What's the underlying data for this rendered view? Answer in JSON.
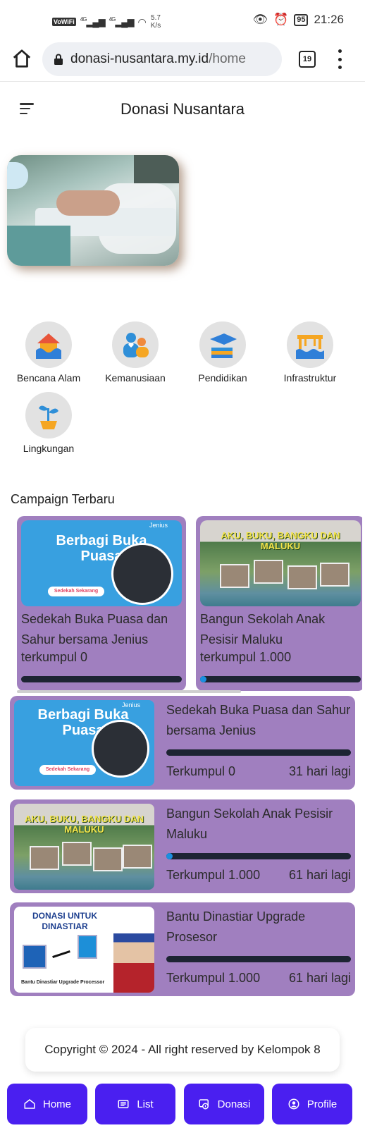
{
  "status_bar": {
    "wifi_label": "VoWiFi",
    "signal_1": "4G",
    "signal_2": "4G",
    "speed_value": "5.7",
    "speed_unit": "K/s",
    "battery": "95",
    "time": "21:26"
  },
  "browser": {
    "url_domain": "donasi-nusantara.my.id",
    "url_path": "/home",
    "tab_count": "19"
  },
  "header": {
    "title": "Donasi Nusantara"
  },
  "categories": [
    {
      "label": "Bencana Alam",
      "icon": "house-flood-icon"
    },
    {
      "label": "Kemanusiaan",
      "icon": "people-heart-icon"
    },
    {
      "label": "Pendidikan",
      "icon": "graduation-cap-icon"
    },
    {
      "label": "Infrastruktur",
      "icon": "bridge-icon"
    },
    {
      "label": "Lingkungan",
      "icon": "plant-sprout-icon"
    }
  ],
  "section": {
    "title": "Campaign Terbaru"
  },
  "carousel": [
    {
      "title": "Sedekah Buka Puasa dan Sahur bersama Jenius",
      "raised_text": "terkumpul 0",
      "progress": 0,
      "image": {
        "heading": "Berbagi Buka Puasa",
        "cta": "Sedekah Sekarang",
        "brand": "Jenius"
      }
    },
    {
      "title": "Bangun Sekolah Anak Pesisir Maluku",
      "raised_text": "terkumpul 1.000",
      "progress": 0.02,
      "image": {
        "heading": "AKU, BUKU, BANGKU DAN MALUKU"
      }
    }
  ],
  "campaigns": [
    {
      "title": "Sedekah Buka Puasa dan Sahur bersama Jenius",
      "raised_text": "Terkumpul 0",
      "days_left": "31 hari lagi",
      "progress": 0,
      "image": {
        "heading": "Berbagi Buka Puasa",
        "cta": "Sedekah Sekarang",
        "brand": "Jenius"
      }
    },
    {
      "title": "Bangun Sekolah Anak Pesisir Maluku",
      "raised_text": "Terkumpul 1.000",
      "days_left": "61 hari lagi",
      "progress": 0.02,
      "image": {
        "heading": "AKU, BUKU, BANGKU DAN MALUKU"
      }
    },
    {
      "title": "Bantu Dinastiar Upgrade Prosesor",
      "raised_text": "Terkumpul 1.000",
      "days_left": "61 hari lagi",
      "progress": 0,
      "image": {
        "heading": "DONASI UNTUK DINASTIAR",
        "caption": "Bantu Dinastiar Upgrade Processor"
      }
    }
  ],
  "footer": {
    "text": "Copyright © 2024 - All right reserved by Kelompok 8"
  },
  "nav": [
    {
      "label": "Home",
      "icon": "home-icon"
    },
    {
      "label": "List",
      "icon": "list-icon"
    },
    {
      "label": "Donasi",
      "icon": "donate-icon"
    },
    {
      "label": "Profile",
      "icon": "profile-icon"
    }
  ],
  "colors": {
    "card_bg": "#a07fbf",
    "progress_track": "#1d2433",
    "progress_fill": "#1a8fe0",
    "nav_bg": "#4a1ff0"
  }
}
